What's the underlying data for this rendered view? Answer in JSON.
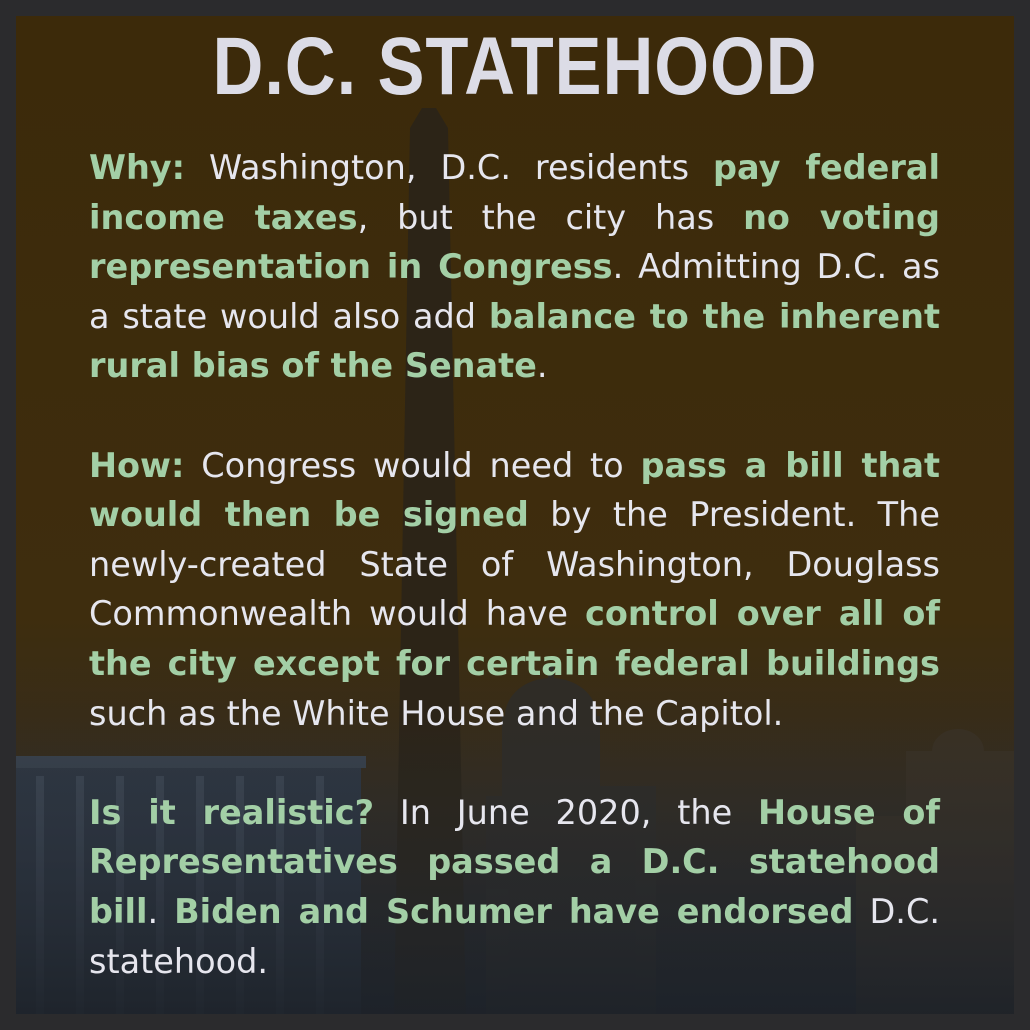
{
  "title": "D.C. STATEHOOD",
  "colors": {
    "highlight": "#a3cfa6",
    "text": "#e6e6ee",
    "frame": "#2b2b2d"
  },
  "paragraphs": [
    {
      "label": "Why:",
      "segments": [
        {
          "text": " Washington, D.C. residents ",
          "hl": false
        },
        {
          "text": "pay federal income taxes",
          "hl": true
        },
        {
          "text": ", but the city has ",
          "hl": false
        },
        {
          "text": "no voting representation in Congress",
          "hl": true
        },
        {
          "text": ". Admitting D.C. as a state would also add ",
          "hl": false
        },
        {
          "text": "balance to the inherent rural bias of the Senate",
          "hl": true
        },
        {
          "text": ".",
          "hl": false
        }
      ]
    },
    {
      "label": "How:",
      "segments": [
        {
          "text": " Congress would need to ",
          "hl": false
        },
        {
          "text": "pass a bill that would then be signed",
          "hl": true
        },
        {
          "text": " by the President. The newly-created State of Washington, Douglass Commonwealth would have ",
          "hl": false
        },
        {
          "text": "control over all of the city except for certain federal buildings",
          "hl": true
        },
        {
          "text": " such as the White House and the Capitol.",
          "hl": false
        }
      ]
    },
    {
      "label": "Is it realistic?",
      "segments": [
        {
          "text": " In June 2020, the ",
          "hl": false
        },
        {
          "text": "House of Representatives passed a D.C. statehood bill",
          "hl": true
        },
        {
          "text": ". ",
          "hl": false
        },
        {
          "text": "Biden and Schumer have endorsed",
          "hl": true
        },
        {
          "text": " D.C. statehood.",
          "hl": false
        }
      ]
    }
  ]
}
